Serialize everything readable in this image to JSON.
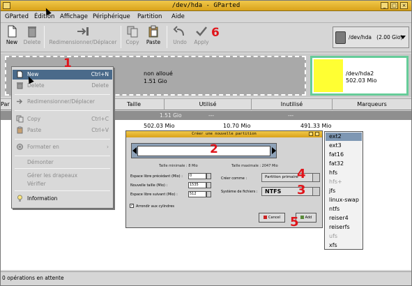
{
  "window": {
    "title": "/dev/hda - GParted"
  },
  "menubar": [
    "GParted",
    "Édition",
    "Affichage",
    "Périphérique",
    "Partition",
    "Aide"
  ],
  "toolbar": {
    "new": "New",
    "delete": "Delete",
    "resize": "Redimensionner/Déplacer",
    "copy": "Copy",
    "paste": "Paste",
    "undo": "Undo",
    "apply": "Apply",
    "device": "/dev/hda",
    "device_size": "(2.00 Gio)"
  },
  "diskmap": {
    "unallocated_label": "non alloué",
    "unallocated_size": "1.51 Gio",
    "partition_name": "/dev/hda2",
    "partition_size": "502.03 Mio"
  },
  "table": {
    "headers": [
      "Par",
      "Taille",
      "Utilisé",
      "Inutilisé",
      "Marqueurs"
    ],
    "selected_row": {
      "size": "1.51 Gio",
      "used": "---",
      "unused": "---"
    },
    "row2": {
      "size": "502.03 Mio",
      "used": "10.70 Mio",
      "unused": "491.33 Mio"
    }
  },
  "status": "0 opérations en attente",
  "context_menu": {
    "items": [
      {
        "label": "New",
        "accel": "Ctrl+N",
        "state": "active",
        "icon": "new-document-icon"
      },
      {
        "label": "Delete",
        "accel": "Delete",
        "state": "disabled",
        "icon": "trash-icon"
      },
      {
        "label": "Redimensionner/Déplacer",
        "accel": "",
        "state": "disabled",
        "icon": "resize-arrow-icon"
      },
      {
        "label": "Copy",
        "accel": "Ctrl+C",
        "state": "disabled",
        "icon": "copy-icon"
      },
      {
        "label": "Paste",
        "accel": "Ctrl+V",
        "state": "disabled",
        "icon": "paste-icon"
      },
      {
        "label": "Formater en",
        "accel": "",
        "state": "disabled",
        "icon": "format-icon"
      },
      {
        "label": "Démonter",
        "accel": "",
        "state": "disabled",
        "icon": ""
      },
      {
        "label": "Gérer les drapeaux",
        "accel": "",
        "state": "disabled",
        "icon": ""
      },
      {
        "label": "Vérifier",
        "accel": "",
        "state": "disabled",
        "icon": ""
      },
      {
        "label": "Information",
        "accel": "",
        "state": "normal",
        "icon": "info-icon"
      }
    ]
  },
  "dialog": {
    "title": "Créer une nouvelle partition",
    "min_size": "Taille minimale : 8 Mio",
    "max_size": "Taille maximale : 2047 Mio",
    "space_before_label": "Espace libre précédant (Mio) :",
    "space_before_value": "0",
    "new_size_label": "Nouvelle taille (Mio) :",
    "new_size_value": "1535",
    "space_after_label": "Espace libre suivant (Mio) :",
    "space_after_value": "512",
    "create_as_label": "Créer comme :",
    "create_as_value": "Partition primaire",
    "fs_label": "Système de fichiers :",
    "fs_value": "NTFS",
    "round_label": "Arrondir aux cylindres",
    "round_checked": "✓",
    "cancel": "Cancel",
    "add": "Add"
  },
  "fs_list": {
    "items": [
      "ext2",
      "ext3",
      "fat16",
      "fat32",
      "hfs",
      "hfs+",
      "jfs",
      "linux-swap",
      "ntfs",
      "reiser4",
      "reiserfs",
      "ufs",
      "xfs"
    ],
    "selected": "ext2",
    "dimmed": [
      "hfs+",
      "ufs"
    ]
  },
  "callouts": [
    "1",
    "2",
    "3",
    "4",
    "5",
    "6"
  ],
  "colors": {
    "titlebar": "#e0b43a",
    "selection": "#4a6a8a",
    "partition_border": "#66cc99",
    "partition_fill": "#ffff33",
    "callout": "#e0151b"
  }
}
